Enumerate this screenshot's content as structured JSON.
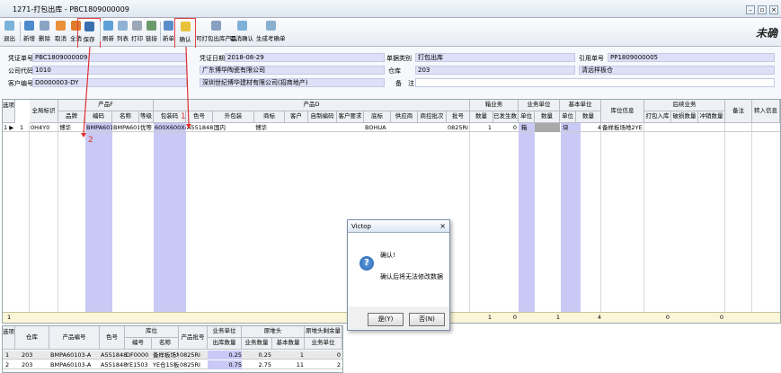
{
  "window": {
    "title": "1271-打包出库 - PBC1809000009",
    "weiqueren": "未确"
  },
  "toolbar": {
    "buttons": [
      "退出",
      "新增",
      "删除",
      "取消",
      "全消",
      "保存",
      "刷新",
      "列表",
      "打印",
      "链接",
      "新单",
      "确认",
      "可打包出库产品",
      "取消确认",
      "生成考确单"
    ]
  },
  "form": {
    "voucher_no_label": "凭证单号",
    "voucher_no": "PBC1809000009",
    "voucher_date_label": "凭证日期",
    "voucher_date": "2018-08-29",
    "doc_type_label": "单据类别",
    "doc_type": "打包出库",
    "ref_no_label": "引用单号",
    "ref_no": "PP1809000005",
    "company_label": "公司代码",
    "company_code": "1010",
    "company_name": "广东博华陶瓷有限公司",
    "warehouse_label": "仓库",
    "warehouse_code": "203",
    "warehouse_name": "清远样板仓",
    "customer_label": "客户编号",
    "customer_code": "D0000003-DY",
    "customer_name": "深圳世纪博华建材有限公司(招商地产)",
    "remark_label": "备　注",
    "remark": ""
  },
  "grid": {
    "group_headers": [
      "产品F",
      "产品D",
      "箱业务",
      "业务单位",
      "基本单位",
      "库位信息",
      "后续业务",
      "备注",
      "转入信息"
    ],
    "columns": [
      "选项",
      "全局标识",
      "品牌",
      "编码",
      "名称",
      "等级",
      "包装码",
      "色号",
      "外包装",
      "商标",
      "客户",
      "自制编码",
      "客户要求",
      "底标",
      "供应商",
      "商控批次",
      "批号",
      "数量",
      "已发生数量",
      "单位",
      "数量",
      "单位",
      "数量",
      "",
      "打包入库",
      "破损数量",
      "冲销数量",
      "",
      ""
    ],
    "row": {
      "sel": "1 ▶",
      "num": "1",
      "gid": "0H4Y0",
      "brand": "博华",
      "code": "BMPA60103-",
      "name": "BMPA60103",
      "grade": "优等",
      "pack": "600X600X4",
      "color": "A551848",
      "outer": "国内",
      "trademark": "博华",
      "ct": "BOHUA",
      "batch": "0825RI",
      "qty": "1",
      "done": "0",
      "unit": "箱",
      "bunit": "块",
      "bqty": "4",
      "loc": "备样板场地2YE"
    },
    "footer": {
      "num": "1",
      "a": "1",
      "b": "0",
      "c": "1",
      "d": "4",
      "e": "0",
      "f": "0"
    }
  },
  "annotations": {
    "one": "1",
    "two": "2"
  },
  "dialog": {
    "title": "Victop",
    "line1": "确认!",
    "line2": "确认后将无法修改数据",
    "yes": "是(Y)",
    "no": "否(N)"
  },
  "grid2": {
    "headers": [
      "选项",
      "仓库",
      "产品编号",
      "色号",
      "库位",
      "编号",
      "名称",
      "产品批号",
      "业务单位",
      "出库数量",
      "原堆头",
      "业务数量",
      "基本数量",
      "原堆头剩余量",
      "业务单位"
    ],
    "rows": [
      {
        "n": "1",
        "wh": "203",
        "pn": "BMPA60103-A",
        "color": "A551848",
        "code": "DF0000",
        "name": "备样板场地",
        "batch": "0825RI",
        "out": "0.25",
        "bq": "0.25",
        "base": "1",
        "rem": "0"
      },
      {
        "n": "2",
        "wh": "203",
        "pn": "BMPA60103-A",
        "color": "A551848",
        "code": "YE1503",
        "name": "YE仓15板位",
        "batch": "0825RI",
        "out": "0.75",
        "bq": "2.75",
        "base": "11",
        "rem": "2"
      }
    ]
  }
}
